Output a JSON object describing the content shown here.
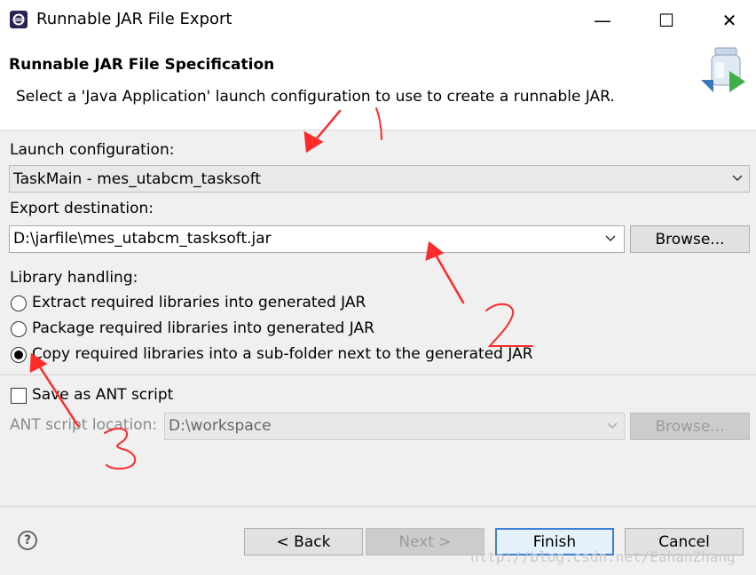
{
  "window": {
    "title": "Runnable JAR File Export",
    "minimize_glyph": "—",
    "maximize_glyph": "☐",
    "close_glyph": "✕"
  },
  "banner": {
    "title": "Runnable JAR File Specification",
    "description": "Select a 'Java Application' launch configuration to use to create a runnable JAR."
  },
  "launch": {
    "label": "Launch configuration:",
    "value": "TaskMain - mes_utabcm_tasksoft"
  },
  "export": {
    "label": "Export destination:",
    "value": "D:\\jarfile\\mes_utabcm_tasksoft.jar",
    "browse_label": "Browse..."
  },
  "library": {
    "label": "Library handling:",
    "options": [
      {
        "label": "Extract required libraries into generated JAR",
        "checked": false
      },
      {
        "label": "Package required libraries into generated JAR",
        "checked": false
      },
      {
        "label": "Copy required libraries into a sub-folder next to the generated JAR",
        "checked": true
      }
    ]
  },
  "ant": {
    "save_label": "Save as ANT script",
    "save_checked": false,
    "location_label": "ANT script location:",
    "location_value": "D:\\workspace",
    "browse_label": "Browse..."
  },
  "footer": {
    "help_glyph": "?",
    "back_label": "< Back",
    "next_label": "Next >",
    "finish_label": "Finish",
    "cancel_label": "Cancel"
  },
  "watermark": "http://blog.csdn.net/EahanZhang",
  "annotations": [
    "1",
    "2",
    "3"
  ],
  "colors": {
    "annotation": "#ff2a2a",
    "default_button_border": "#3c7fd6"
  }
}
